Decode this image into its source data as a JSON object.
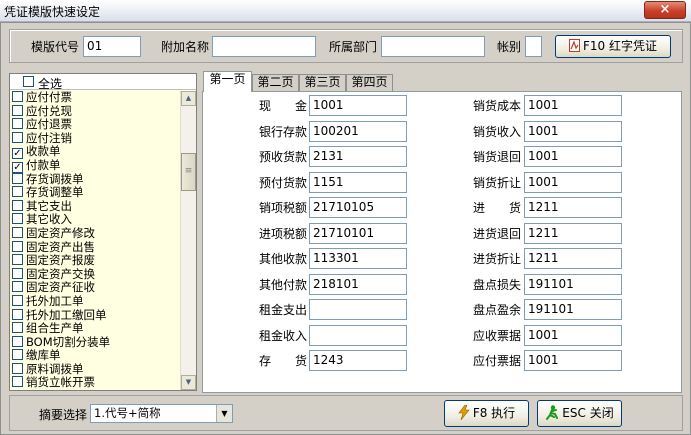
{
  "window": {
    "title": "凭证模版快速设定",
    "close_glyph": "×"
  },
  "header": {
    "template_code_label": "模版代号",
    "template_code_value": "01",
    "extra_name_label": "附加名称",
    "extra_name_value": "",
    "dept_label": "所属部门",
    "dept_value": "",
    "book_label": "帐别",
    "book_value": "",
    "red_voucher_button": "F10 红字凭证"
  },
  "list": {
    "select_all_label": "全选",
    "items": [
      {
        "label": "应付付票",
        "checked": false
      },
      {
        "label": "应付兑现",
        "checked": false
      },
      {
        "label": "应付退票",
        "checked": false
      },
      {
        "label": "应付注销",
        "checked": false
      },
      {
        "label": "收款单",
        "checked": true
      },
      {
        "label": "付款单",
        "checked": true
      },
      {
        "label": "存货调拨单",
        "checked": false
      },
      {
        "label": "存货调整单",
        "checked": false
      },
      {
        "label": "其它支出",
        "checked": false
      },
      {
        "label": "其它收入",
        "checked": false
      },
      {
        "label": "固定资产修改",
        "checked": false
      },
      {
        "label": "固定资产出售",
        "checked": false
      },
      {
        "label": "固定资产报废",
        "checked": false
      },
      {
        "label": "固定资产交换",
        "checked": false
      },
      {
        "label": "固定资产征收",
        "checked": false
      },
      {
        "label": "托外加工单",
        "checked": false
      },
      {
        "label": "托外加工缴回单",
        "checked": false
      },
      {
        "label": "组合生产单",
        "checked": false
      },
      {
        "label": "BOM切割分装单",
        "checked": false
      },
      {
        "label": "缴库单",
        "checked": false
      },
      {
        "label": "原料调拨单",
        "checked": false
      },
      {
        "label": "销货立帐开票",
        "checked": false
      }
    ]
  },
  "tabs": [
    "第一页",
    "第二页",
    "第三页",
    "第四页"
  ],
  "fields_left": [
    {
      "label": "现　　金",
      "value": "1001"
    },
    {
      "label": "银行存款",
      "value": "100201"
    },
    {
      "label": "预收货款",
      "value": "2131"
    },
    {
      "label": "预付货款",
      "value": "1151"
    },
    {
      "label": "销项税额",
      "value": "21710105"
    },
    {
      "label": "进项税额",
      "value": "21710101"
    },
    {
      "label": "其他收款",
      "value": "113301"
    },
    {
      "label": "其他付款",
      "value": "218101"
    },
    {
      "label": "租金支出",
      "value": ""
    },
    {
      "label": "租金收入",
      "value": ""
    },
    {
      "label": "存　　货",
      "value": "1243"
    }
  ],
  "fields_right": [
    {
      "label": "销货成本",
      "value": "1001"
    },
    {
      "label": "销货收入",
      "value": "1001"
    },
    {
      "label": "销货退回",
      "value": "1001"
    },
    {
      "label": "销货折让",
      "value": "1001"
    },
    {
      "label": "进　　货",
      "value": "1211"
    },
    {
      "label": "进货退回",
      "value": "1211"
    },
    {
      "label": "进货折让",
      "value": "1211"
    },
    {
      "label": "盘点损失",
      "value": "191101"
    },
    {
      "label": "盘点盈余",
      "value": "191101"
    },
    {
      "label": "应收票据",
      "value": "1001"
    },
    {
      "label": "应付票据",
      "value": "1001"
    }
  ],
  "footer": {
    "summary_label": "摘要选择",
    "summary_value": "1.代号+简称",
    "execute_button": "F8 执行",
    "close_button": "ESC 关闭"
  },
  "colors": {
    "list_background": "#ffffe1",
    "close_button": "#c8412a",
    "execute_icon": "#e0a000",
    "close_icon": "#1a9a1a"
  }
}
